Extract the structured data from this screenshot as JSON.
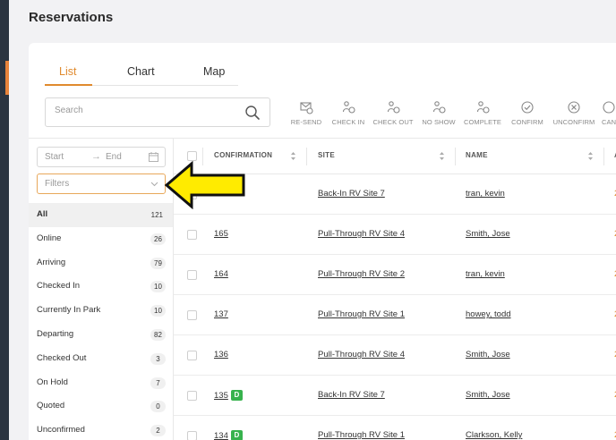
{
  "page": {
    "title": "Reservations"
  },
  "colors": {
    "accent": "#e08a2e",
    "badge_green": "#37b24d",
    "sidebar": "#2b3440",
    "annotation_arrow": "#ffeb00"
  },
  "tabs": [
    {
      "label": "List",
      "active": true
    },
    {
      "label": "Chart",
      "active": false
    },
    {
      "label": "Map",
      "active": false
    }
  ],
  "search": {
    "placeholder": "Search",
    "icon": "search-icon"
  },
  "actions": [
    {
      "label": "RE-SEND",
      "icon": "resend-mail-icon"
    },
    {
      "label": "CHECK IN",
      "icon": "check-in-icon"
    },
    {
      "label": "CHECK OUT",
      "icon": "check-out-icon"
    },
    {
      "label": "NO SHOW",
      "icon": "no-show-icon"
    },
    {
      "label": "COMPLETE",
      "icon": "complete-icon"
    },
    {
      "label": "CONFIRM",
      "icon": "confirm-check-icon"
    },
    {
      "label": "UNCONFIRM",
      "icon": "unconfirm-x-icon"
    },
    {
      "label": "CAN",
      "icon": "cancel-icon"
    }
  ],
  "date_range": {
    "start_placeholder": "Start",
    "arrow": "→",
    "end_placeholder": "End"
  },
  "filters_select": {
    "placeholder": "Filters"
  },
  "filter_list": [
    {
      "label": "All",
      "count": "121",
      "active": true
    },
    {
      "label": "Online",
      "count": "26"
    },
    {
      "label": "Arriving",
      "count": "79"
    },
    {
      "label": "Checked In",
      "count": "10"
    },
    {
      "label": "Currently In Park",
      "count": "10"
    },
    {
      "label": "Departing",
      "count": "82"
    },
    {
      "label": "Checked Out",
      "count": "3"
    },
    {
      "label": "On Hold",
      "count": "7"
    },
    {
      "label": "Quoted",
      "count": "0"
    },
    {
      "label": "Unconfirmed",
      "count": "2"
    }
  ],
  "table": {
    "columns": {
      "confirmation": "CONFIRMATION",
      "site": "SITE",
      "name": "NAME",
      "edge": "A"
    },
    "rows": [
      {
        "confirmation": "",
        "badge": "",
        "site": "Back-In RV Site 7",
        "name": "tran, kevin",
        "edge": "2"
      },
      {
        "confirmation": "165",
        "badge": "",
        "site": "Pull-Through RV Site 4",
        "name": "Smith, Jose",
        "edge": "2"
      },
      {
        "confirmation": "164",
        "badge": "",
        "site": "Pull-Through RV Site 2",
        "name": "tran, kevin",
        "edge": "2"
      },
      {
        "confirmation": "137",
        "badge": "",
        "site": "Pull-Through RV Site 1",
        "name": "howey, todd",
        "edge": "2"
      },
      {
        "confirmation": "136",
        "badge": "",
        "site": "Pull-Through RV Site 4",
        "name": "Smith, Jose",
        "edge": "2"
      },
      {
        "confirmation": "135",
        "badge": "D",
        "site": "Back-In RV Site 7",
        "name": "Smith, Jose",
        "edge": "2"
      },
      {
        "confirmation": "134",
        "badge": "D",
        "site": "Pull-Through RV Site 1",
        "name": "Clarkson, Kelly",
        "edge": "2"
      }
    ]
  }
}
